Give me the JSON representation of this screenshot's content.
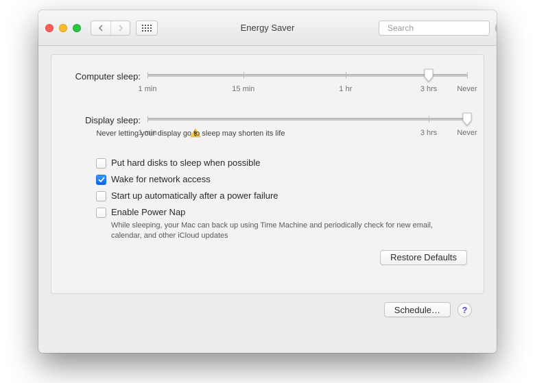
{
  "window": {
    "title": "Energy Saver",
    "search_placeholder": "Search"
  },
  "sliders": {
    "computer": {
      "label": "Computer sleep:",
      "position_pct": 88,
      "ticks": {
        "min": "1 min",
        "mid1": "15 min",
        "mid2": "1 hr",
        "max": "3 hrs",
        "never": "Never"
      }
    },
    "display": {
      "label": "Display sleep:",
      "position_pct": 100,
      "warning": "Never letting your display go to sleep may shorten its life",
      "ticks": {
        "min": "1 min",
        "max": "3 hrs",
        "never": "Never"
      }
    }
  },
  "options": {
    "hard_disks": {
      "label": "Put hard disks to sleep when possible",
      "checked": false
    },
    "wake_network": {
      "label": "Wake for network access",
      "checked": true
    },
    "start_auto": {
      "label": "Start up automatically after a power failure",
      "checked": false
    },
    "power_nap": {
      "label": "Enable Power Nap",
      "checked": false,
      "description": "While sleeping, your Mac can back up using Time Machine and periodically check for new email, calendar, and other iCloud updates"
    }
  },
  "buttons": {
    "restore": "Restore Defaults",
    "schedule": "Schedule…"
  }
}
